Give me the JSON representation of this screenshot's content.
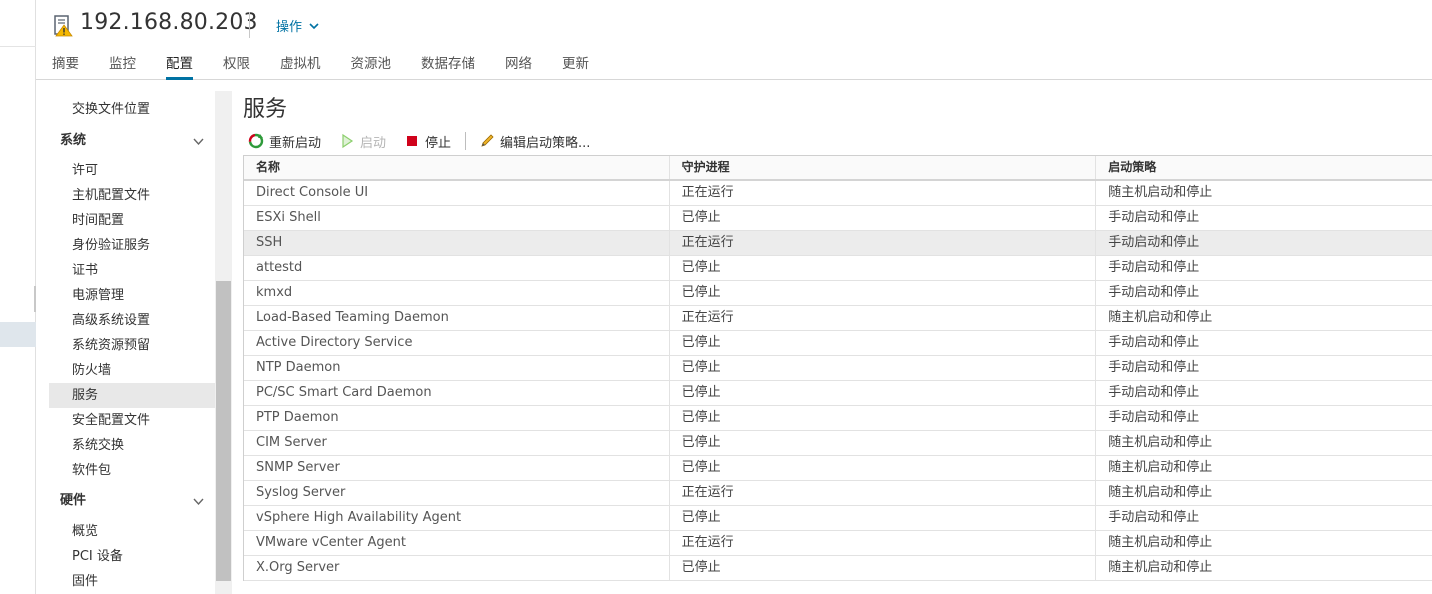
{
  "header": {
    "host_title": "192.168.80.203",
    "actions_label": "操作"
  },
  "tabs": [
    {
      "label": "摘要"
    },
    {
      "label": "监控"
    },
    {
      "label": "配置",
      "active": true
    },
    {
      "label": "权限"
    },
    {
      "label": "虚拟机"
    },
    {
      "label": "资源池"
    },
    {
      "label": "数据存储"
    },
    {
      "label": "网络"
    },
    {
      "label": "更新"
    }
  ],
  "sidebar": {
    "top_items": [
      "交换文件位置"
    ],
    "system_group": "系统",
    "system_items": [
      "许可",
      "主机配置文件",
      "时间配置",
      "身份验证服务",
      "证书",
      "电源管理",
      "高级系统设置",
      "系统资源预留",
      "防火墙",
      "服务",
      "安全配置文件",
      "系统交换",
      "软件包"
    ],
    "selected": "服务",
    "hardware_group": "硬件",
    "hardware_items": [
      "概览",
      "PCI 设备",
      "固件"
    ]
  },
  "main": {
    "title": "服务",
    "toolbar": {
      "restart_label": "重新启动",
      "start_label": "启动",
      "stop_label": "停止",
      "edit_policy_label": "编辑启动策略..."
    },
    "columns": [
      "名称",
      "守护进程",
      "启动策略"
    ],
    "rows": [
      [
        "Direct Console UI",
        "正在运行",
        "随主机启动和停止"
      ],
      [
        "ESXi Shell",
        "已停止",
        "手动启动和停止"
      ],
      [
        "SSH",
        "正在运行",
        "手动启动和停止"
      ],
      [
        "attestd",
        "已停止",
        "手动启动和停止"
      ],
      [
        "kmxd",
        "已停止",
        "手动启动和停止"
      ],
      [
        "Load-Based Teaming Daemon",
        "正在运行",
        "随主机启动和停止"
      ],
      [
        "Active Directory Service",
        "已停止",
        "手动启动和停止"
      ],
      [
        "NTP Daemon",
        "已停止",
        "手动启动和停止"
      ],
      [
        "PC/SC Smart Card Daemon",
        "已停止",
        "手动启动和停止"
      ],
      [
        "PTP Daemon",
        "已停止",
        "手动启动和停止"
      ],
      [
        "CIM Server",
        "已停止",
        "随主机启动和停止"
      ],
      [
        "SNMP Server",
        "已停止",
        "随主机启动和停止"
      ],
      [
        "Syslog Server",
        "正在运行",
        "随主机启动和停止"
      ],
      [
        "vSphere High Availability Agent",
        "已停止",
        "手动启动和停止"
      ],
      [
        "VMware vCenter Agent",
        "正在运行",
        "随主机启动和停止"
      ],
      [
        "X.Org Server",
        "已停止",
        "随主机启动和停止"
      ]
    ],
    "selected_row": "SSH"
  },
  "colors": {
    "accent": "#0072a3",
    "stop_red": "#d0021b",
    "start_green": "#8ccf6d",
    "selected_bg": "#ececec"
  }
}
